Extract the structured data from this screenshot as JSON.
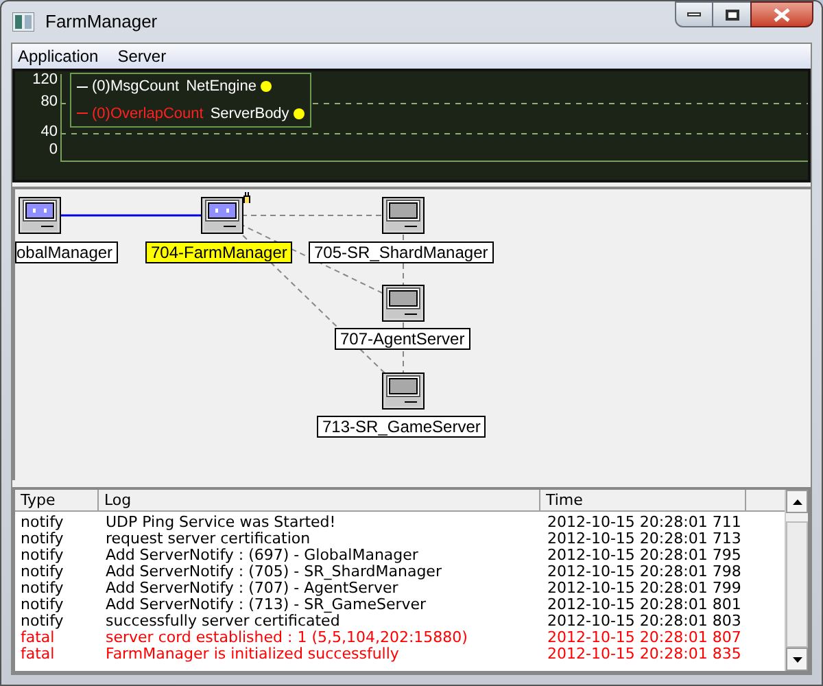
{
  "window": {
    "title": "FarmManager"
  },
  "menu": [
    "Application",
    "Server"
  ],
  "graph": {
    "y_labels": [
      "120",
      "80",
      "40",
      "0"
    ],
    "legend": [
      {
        "label": "(0)MsgCount",
        "source": "NetEngine",
        "color": "#ffffff"
      },
      {
        "label": "(0)OverlapCount",
        "source": "ServerBody",
        "color": "#ff2020"
      }
    ]
  },
  "network": {
    "nodes": [
      {
        "label": "obalManager",
        "kind": "online",
        "selected": false
      },
      {
        "label": "704-FarmManager",
        "kind": "online",
        "selected": true
      },
      {
        "label": "705-SR_ShardManager",
        "kind": "offline",
        "selected": false
      },
      {
        "label": "707-AgentServer",
        "kind": "offline",
        "selected": false
      },
      {
        "label": "713-SR_GameServer",
        "kind": "offline",
        "selected": false
      }
    ]
  },
  "log": {
    "columns": [
      "Type",
      "Log",
      "Time"
    ],
    "rows": [
      {
        "kind": "notify",
        "type": "notify",
        "log": "UDP Ping Service was Started!",
        "time": "2012-10-15 20:28:01 711"
      },
      {
        "kind": "notify",
        "type": "notify",
        "log": "request server certification",
        "time": "2012-10-15 20:28:01 713"
      },
      {
        "kind": "notify",
        "type": "notify",
        "log": "Add ServerNotify : (697) - GlobalManager",
        "time": "2012-10-15 20:28:01 795"
      },
      {
        "kind": "notify",
        "type": "notify",
        "log": "Add ServerNotify : (705) - SR_ShardManager",
        "time": "2012-10-15 20:28:01 798"
      },
      {
        "kind": "notify",
        "type": "notify",
        "log": "Add ServerNotify : (707) - AgentServer",
        "time": "2012-10-15 20:28:01 799"
      },
      {
        "kind": "notify",
        "type": "notify",
        "log": "Add ServerNotify : (713) - SR_GameServer",
        "time": "2012-10-15 20:28:01 801"
      },
      {
        "kind": "notify",
        "type": "notify",
        "log": "successfully server certificated",
        "time": "2012-10-15 20:28:01 803"
      },
      {
        "kind": "fatal",
        "type": "fatal",
        "log": "server cord established : 1 (5,5,104,202:15880)",
        "time": "2012-10-15 20:28:01 807"
      },
      {
        "kind": "fatal",
        "type": "fatal",
        "log": "FarmManager is initialized successfully",
        "time": "2012-10-15 20:28:01 835"
      }
    ]
  }
}
